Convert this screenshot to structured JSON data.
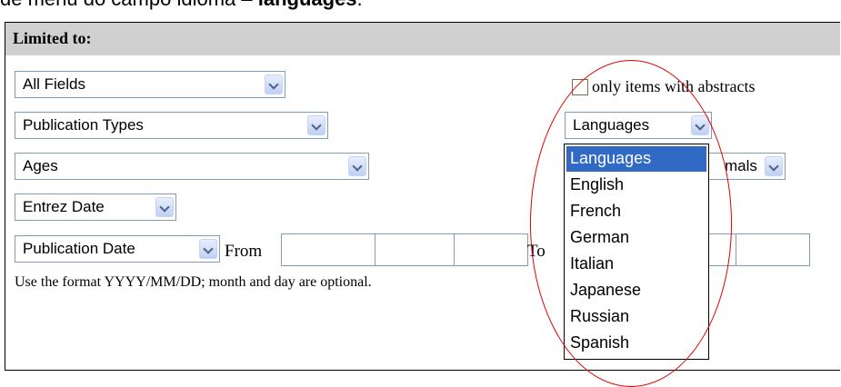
{
  "caption": {
    "prefix": "de menu do campo idioma – ",
    "emphasis": "languages",
    "suffix": "."
  },
  "panel": {
    "title": "Limited to:"
  },
  "selects": {
    "fields": "All Fields",
    "publication_types": "Publication Types",
    "ages": "Ages",
    "entrez_date": "Entrez Date",
    "publication_date": "Publication Date",
    "languages": "Languages",
    "subsets_partial": "mals"
  },
  "checkbox": {
    "label": "only items with abstracts",
    "checked": false
  },
  "date_range": {
    "from_label": "From",
    "to_label": "To",
    "hint": "Use the format YYYY/MM/DD; month and day are optional."
  },
  "language_list": {
    "selected": "Languages",
    "options": [
      "Languages",
      "English",
      "French",
      "German",
      "Italian",
      "Japanese",
      "Russian",
      "Spanish"
    ]
  },
  "colors": {
    "header_bg": "#d0d0d0",
    "selection": "#316ac5",
    "highlight_ellipse": "#e00000",
    "field_border": "#7f9db9"
  }
}
